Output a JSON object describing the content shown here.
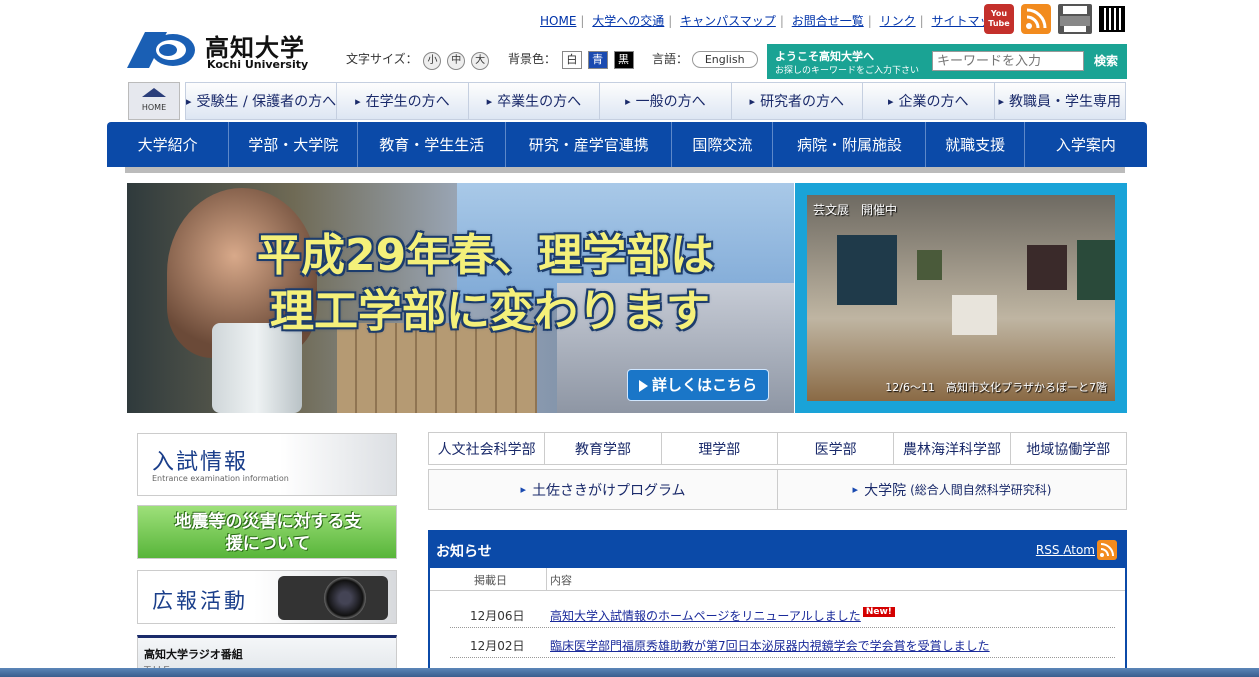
{
  "header": {
    "logo_jp": "高知大学",
    "logo_en": "Kochi University",
    "top_links": [
      "HOME",
      "大学への交通",
      "キャンパスマップ",
      "お問合せ一覧",
      "リンク",
      "サイトマップ"
    ],
    "youtube_label": "You Tube",
    "font_size_label": "文字サイズ：",
    "font_sizes": [
      "小",
      "中",
      "大"
    ],
    "bg_color_label": "背景色：",
    "bg_colors": [
      "白",
      "青",
      "黒"
    ],
    "language_label": "言語：",
    "language_button": "English"
  },
  "search": {
    "welcome": "ようこそ高知大学へ",
    "hint": "お探しのキーワードをご入力下さい",
    "placeholder": "キーワードを入力",
    "button": "検索"
  },
  "home_label": "HOME",
  "audience_tabs": [
    "受験生 / 保護者の方へ",
    "在学生の方へ",
    "卒業生の方へ",
    "一般の方へ",
    "研究者の方へ",
    "企業の方へ",
    "教職員・学生専用"
  ],
  "main_nav": [
    "大学紹介",
    "学部・大学院",
    "教育・学生生活",
    "研究・産学官連携",
    "国際交流",
    "病院・附属施設",
    "就職支援",
    "入学案内"
  ],
  "hero": {
    "headline_1": "平成29年春、理学部は",
    "headline_2": "理工学部に変わります",
    "more_button": "詳しくはこちら"
  },
  "exhibition": {
    "title": "芸文展　開催中",
    "caption": "12/6～11　高知市文化プラザかるぽーと7階"
  },
  "banners": {
    "exam_title": "入試情報",
    "exam_sub": "Entrance examination information",
    "disaster": "地震等の災害に対する支援について",
    "pr_title": "広報活動",
    "radio_title": "高知大学ラジオ番組",
    "radio_sub": "THE"
  },
  "faculties": [
    "人文社会科学部",
    "教育学部",
    "理学部",
    "医学部",
    "農林海洋科学部",
    "地域協働学部"
  ],
  "programs": {
    "tosa": "土佐さきがけプログラム",
    "graduate": "大学院",
    "graduate_sub": "(総合人間自然科学研究科)"
  },
  "news": {
    "title": "お知らせ",
    "rss": "RSS",
    "atom": "Atom",
    "col_date": "掲載日",
    "col_content": "内容",
    "items": [
      {
        "date": "12月06日",
        "text": "高知大学入試情報のホームページをリニューアルしました",
        "badge": "New!"
      },
      {
        "date": "12月02日",
        "text": "臨床医学部門福原秀雄助教が第7回日本泌尿器内視鏡学会で学会賞を受賞しました"
      }
    ]
  },
  "colors": {
    "nav_blue": "#0b4aa8",
    "teal": "#1aa394",
    "exhibit_blue": "#1aa3d8"
  }
}
